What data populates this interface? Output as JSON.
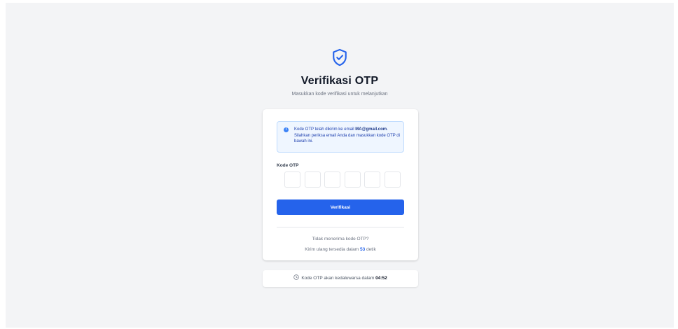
{
  "header": {
    "icon": "shield-check-icon",
    "title": "Verifikasi OTP",
    "subtitle": "Masukkan kode verifikasi untuk melanjutkan"
  },
  "info": {
    "icon": "info-icon",
    "text_before": "Kode OTP telah dikirim ke email ",
    "email": "MA@gmail.com",
    "text_after": ". Silahkan periksa email Anda dan masukkan kode OTP di bawah ini."
  },
  "otp": {
    "label": "Kode OTP",
    "digits": [
      "",
      "",
      "",
      "",
      "",
      ""
    ]
  },
  "verify_button": "Verifikasi",
  "resend": {
    "question": "Tidak menerima kode OTP?",
    "timer_prefix": "Kirim ulang tersedia dalam ",
    "seconds": "53",
    "timer_suffix": " detik"
  },
  "expiry": {
    "icon": "clock-icon",
    "prefix": "Kode OTP akan kedaluwarsa dalam ",
    "time": "04:52"
  },
  "colors": {
    "accent": "#2563eb",
    "background": "#f3f4f6",
    "info_bg": "#eff6ff"
  }
}
